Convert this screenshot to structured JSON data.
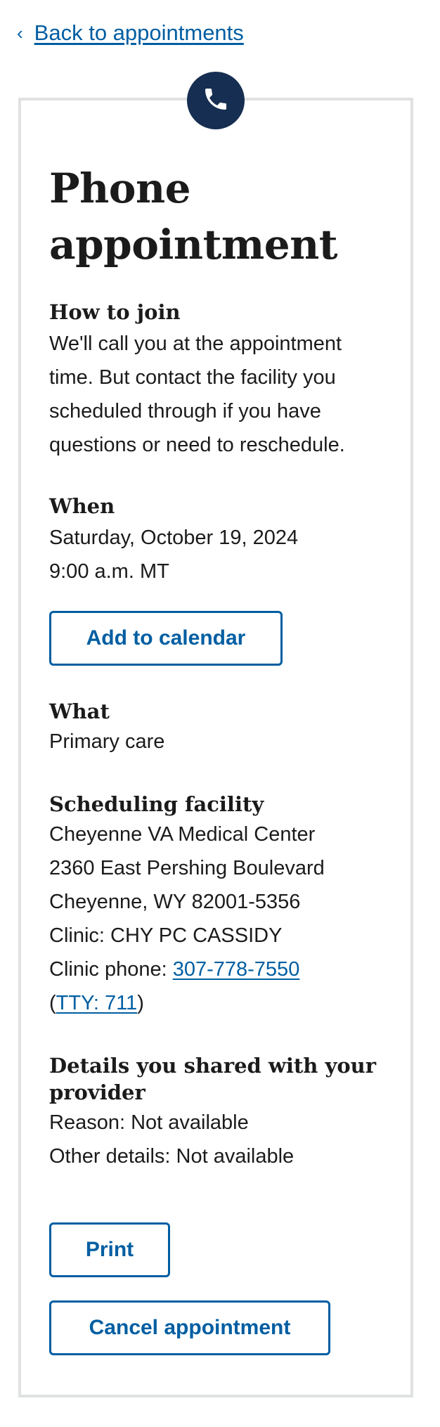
{
  "nav": {
    "back_chevron": "‹",
    "back_label": "Back to appointments"
  },
  "header": {
    "icon": "phone-icon",
    "title_line1": "Phone",
    "title_line2": "appointment"
  },
  "how_to_join": {
    "label": "How to join",
    "lines": [
      "We'll call you at the appointment",
      "time. But contact the facility you",
      "scheduled through if you have",
      "questions or need to reschedule."
    ]
  },
  "when": {
    "label": "When",
    "date": "Saturday, October 19, 2024",
    "time": "9:00 a.m. MT",
    "add_to_calendar": "Add to calendar"
  },
  "what": {
    "label": "What",
    "value": "Primary care"
  },
  "facility": {
    "label": "Scheduling facility",
    "name": "Cheyenne VA Medical Center",
    "address1": "2360 East Pershing Boulevard",
    "address2": "Cheyenne, WY 82001-5356",
    "clinic": "Clinic: CHY PC CASSIDY",
    "phone_prefix": "Clinic phone: ",
    "phone": "307-778-7550",
    "tty_open": "(",
    "tty": "TTY: 711",
    "tty_close": ")"
  },
  "details": {
    "label_line1": "Details you shared with your",
    "label_line2": "provider",
    "reason": "Reason: Not available",
    "other": "Other details: Not available"
  },
  "actions": {
    "print": "Print",
    "cancel": "Cancel appointment"
  },
  "colors": {
    "link": "#005ea2",
    "badge": "#162e51",
    "border": "#dfe1e2"
  }
}
